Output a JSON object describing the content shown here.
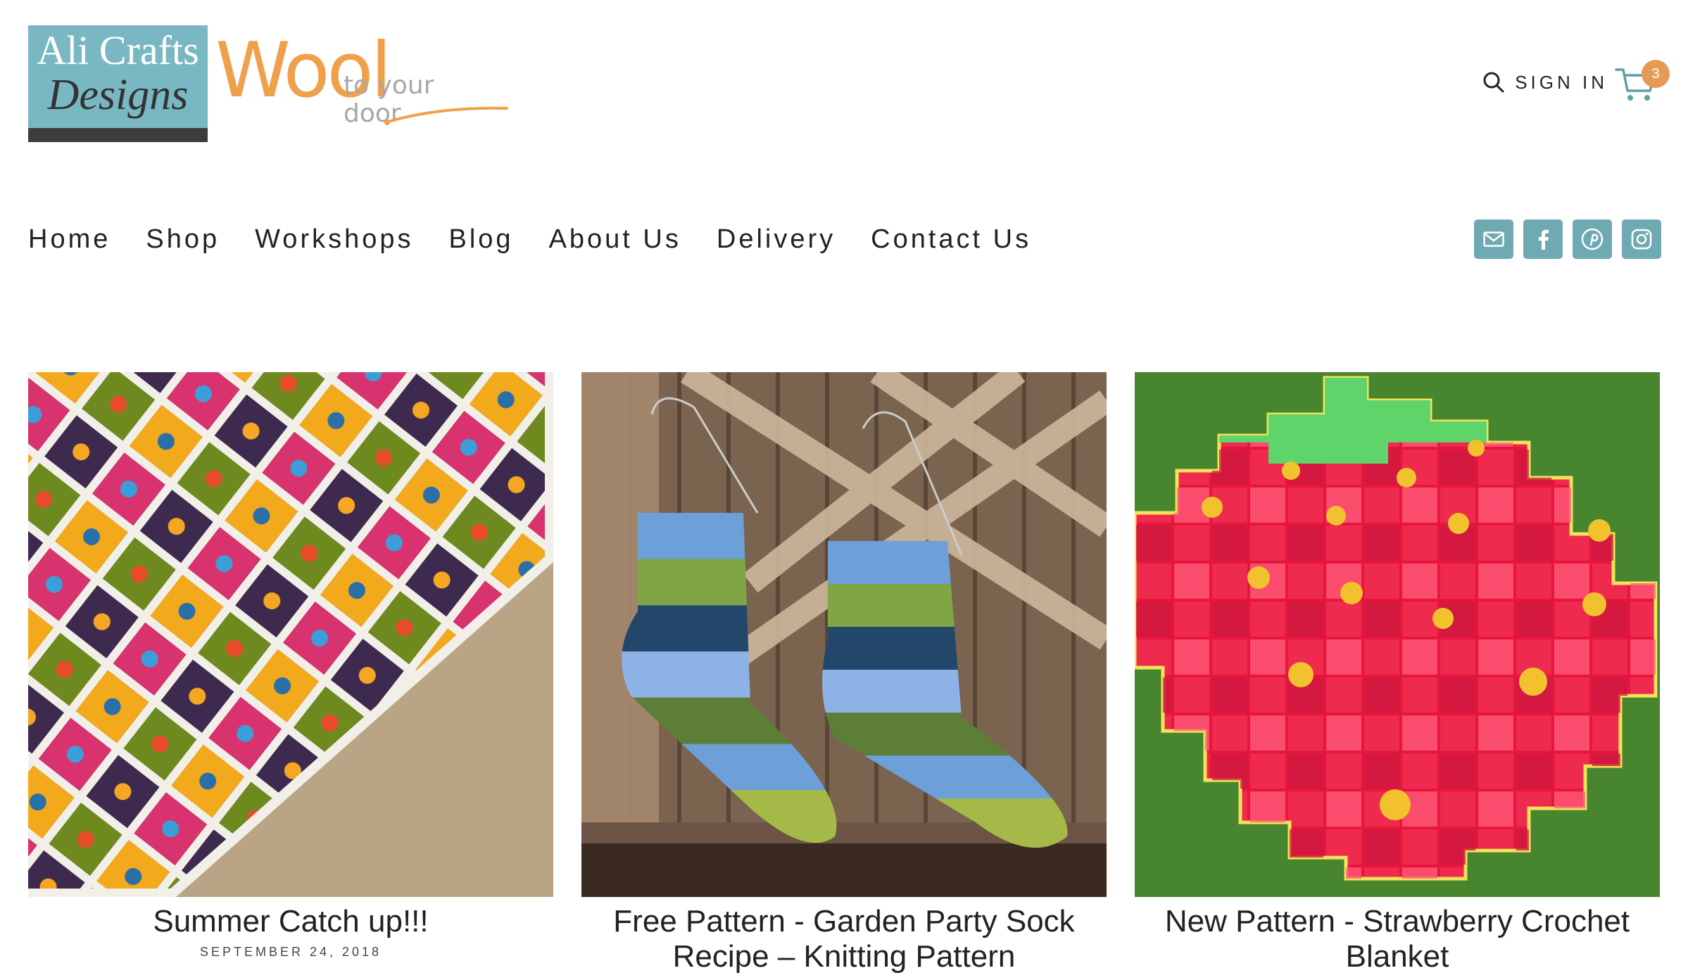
{
  "logo": {
    "line1": "Ali Crafts",
    "line2": "Designs",
    "wool": "Wool",
    "tagline": "to your door",
    "colors": {
      "box": "#79b8c3",
      "bar": "#3d3d3d",
      "wool": "#f0a04b"
    }
  },
  "header": {
    "search_icon": "search-icon",
    "signin_label": "SIGN IN",
    "cart_icon": "cart-icon",
    "cart_count": "3"
  },
  "nav": {
    "items": [
      {
        "label": "Home"
      },
      {
        "label": "Shop"
      },
      {
        "label": "Workshops"
      },
      {
        "label": "Blog"
      },
      {
        "label": "About Us"
      },
      {
        "label": "Delivery"
      },
      {
        "label": "Contact Us"
      }
    ]
  },
  "social": {
    "color": "#6faab3",
    "icons": [
      "email-icon",
      "facebook-icon",
      "pinterest-icon",
      "instagram-icon"
    ]
  },
  "posts": [
    {
      "title": "Summer Catch up!!!",
      "date": "SEPTEMBER 24, 2018"
    },
    {
      "title": "Free Pattern - Garden Party Sock Recipe – Knitting Pattern",
      "date": ""
    },
    {
      "title": "New Pattern - Strawberry Crochet Blanket",
      "date": ""
    }
  ]
}
